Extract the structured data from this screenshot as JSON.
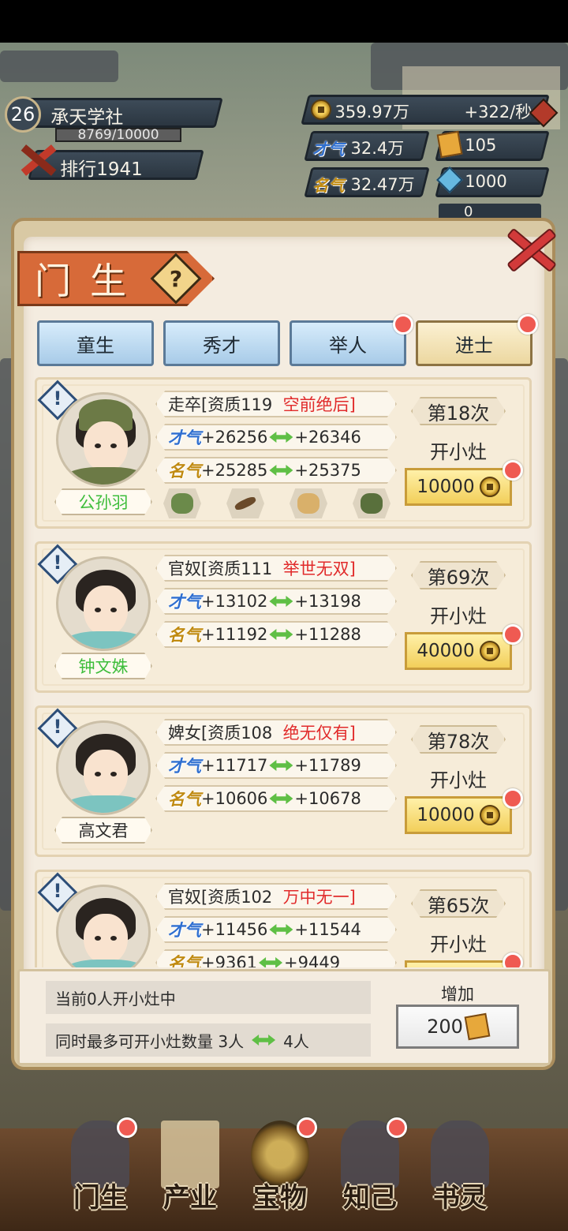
{
  "hud": {
    "level": "26",
    "academy_name": "承天学社",
    "exp": "8769/10000",
    "rank_label": "排行",
    "rank_value": "1941",
    "coins": "359.97万",
    "coins_rate": "+322/秒",
    "talent_label": "才气",
    "talent_value": "32.4万",
    "fame_label": "名气",
    "fame_value": "32.47万",
    "gold_token_value": "105",
    "gem_value": "1000",
    "ingot_value": "0"
  },
  "panel": {
    "title": "门生",
    "help": "?",
    "tabs": [
      {
        "label": "童生"
      },
      {
        "label": "秀才"
      },
      {
        "label": "举人"
      },
      {
        "label": "进士"
      }
    ]
  },
  "students": [
    {
      "name": "公孙羽",
      "origin": "走卒[资质119",
      "rarity": "空前绝后]",
      "rarity_word": "空前绝后",
      "talent_from": "+26256",
      "talent_to": "+26346",
      "fame_from": "+25285",
      "fame_to": "+25375",
      "count": "第18次",
      "action": "开小灶",
      "cost": "10000"
    },
    {
      "name": "钟文姝",
      "origin": "官奴[资质111",
      "rarity": "举世无双]",
      "rarity_word": "举世无双",
      "talent_from": "+13102",
      "talent_to": "+13198",
      "fame_from": "+11192",
      "fame_to": "+11288",
      "count": "第69次",
      "action": "开小灶",
      "cost": "40000"
    },
    {
      "name": "高文君",
      "origin": "婢女[资质108",
      "rarity": "绝无仅有]",
      "rarity_word": "绝无仅有",
      "talent_from": "+11717",
      "talent_to": "+11789",
      "fame_from": "+10606",
      "fame_to": "+10678",
      "count": "第78次",
      "action": "开小灶",
      "cost": "10000"
    },
    {
      "name": "",
      "origin": "官奴[资质102",
      "rarity": "万中无一]",
      "rarity_word": "万中无一",
      "talent_from": "+11456",
      "talent_to": "+11544",
      "fame_from": "+9361",
      "fame_to": "+9449",
      "count": "第65次",
      "action": "开小灶",
      "cost": ""
    }
  ],
  "footer": {
    "current_text": "当前0人开小灶中",
    "max_text": "同时最多可开小灶数量 3人",
    "max_next": "4人",
    "increase_label": "增加",
    "increase_cost": "200"
  },
  "nav": [
    {
      "label": "门生"
    },
    {
      "label": "产业"
    },
    {
      "label": "宝物"
    },
    {
      "label": "知己"
    },
    {
      "label": "书灵"
    }
  ],
  "colors": {
    "panel_title_bg": "#d76a39",
    "rarity_red": "#e12b2b",
    "name_green": "#3dbd3b",
    "notify_red": "#ef5a52",
    "talent_blue": "#2f6fd0",
    "fame_gold": "#c08a10"
  }
}
